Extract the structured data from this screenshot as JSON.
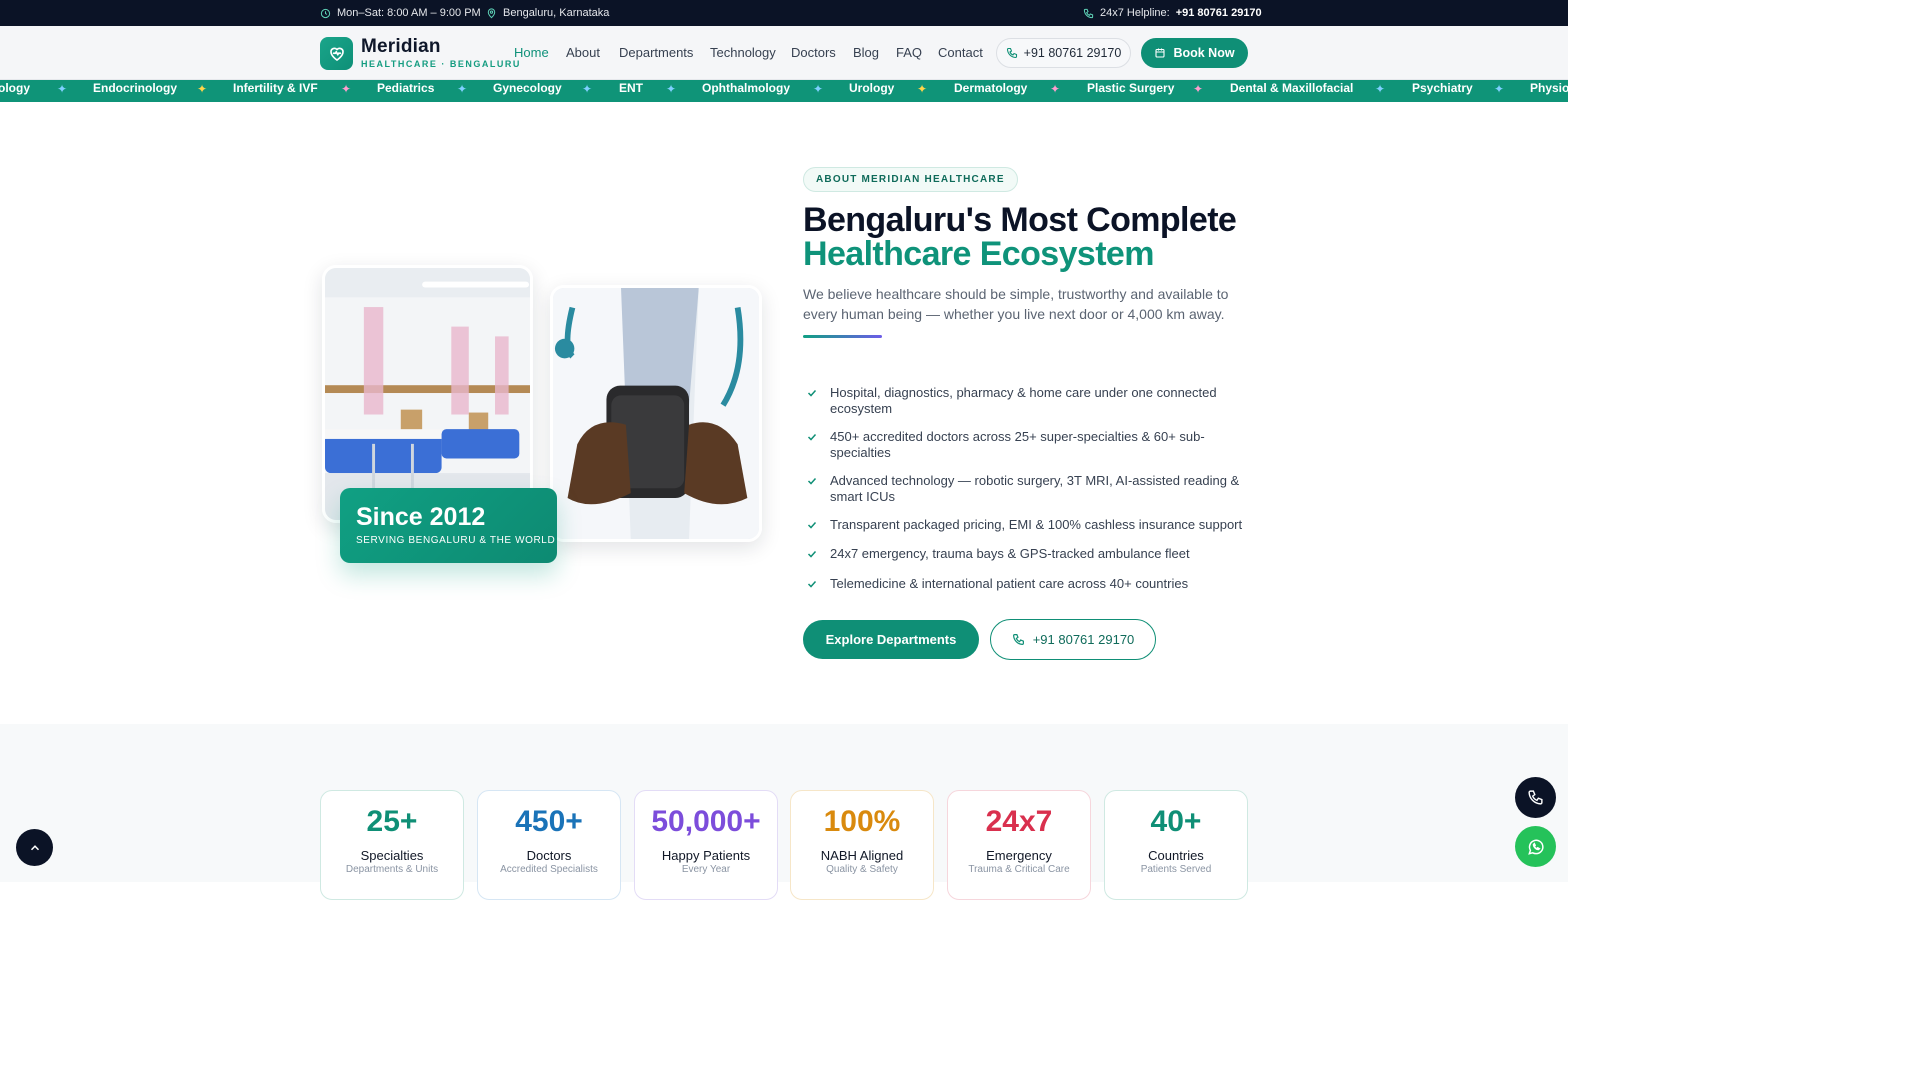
{
  "topbar": {
    "hours": "Mon–Sat: 8:00 AM – 9:00 PM",
    "location": "Bengaluru, Karnataka",
    "helpline_label": "24x7 Helpline:",
    "helpline_number": "+91 80761 29170"
  },
  "nav": {
    "brand": "Meridian",
    "brand_sub": "HEALTHCARE · BENGALURU",
    "items": [
      "Home",
      "About",
      "Departments",
      "Technology",
      "Doctors",
      "Blog",
      "FAQ",
      "Contact"
    ],
    "active": "Home",
    "phone": "+91 80761 29170",
    "book_label": "Book Now"
  },
  "ticker": {
    "items": [
      "ology",
      "Endocrinology",
      "Infertility & IVF",
      "Pediatrics",
      "Gynecology",
      "ENT",
      "Ophthalmology",
      "Urology",
      "Dermatology",
      "Plastic Surgery",
      "Dental & Maxillofacial",
      "Psychiatry",
      "Physio"
    ],
    "star_colors": [
      "#7fd0ff",
      "#ffd54a",
      "#ff9ecf",
      "#7fd0ff",
      "#7fd0ff",
      "#7fd0ff",
      "#7fd0ff",
      "#ffd54a",
      "#ff9ecf",
      "#ff9ecf",
      "#7fd0ff",
      "#7fd0ff"
    ]
  },
  "about": {
    "tag": "ABOUT MERIDIAN HEALTHCARE",
    "heading_line1": "Bengaluru's Most Complete",
    "heading_line2": "Healthcare Ecosystem",
    "lead": "We believe healthcare should be simple, trustworthy and available to every human being — whether you live next door or 4,000 km away.",
    "since_year": "Since 2012",
    "since_sub": "SERVING BENGALURU & THE WORLD",
    "features": [
      "Hospital, diagnostics, pharmacy & home care under one connected ecosystem",
      "450+ accredited doctors across 25+ super-specialties & 60+ sub-specialties",
      "Advanced technology — robotic surgery, 3T MRI, AI-assisted reading & smart ICUs",
      "Transparent packaged pricing, EMI & 100% cashless insurance support",
      "24x7 emergency, trauma bays & GPS-tracked ambulance fleet",
      "Telemedicine & international patient care across 40+ countries"
    ],
    "explore_label": "Explore Departments",
    "call_label": "+91 80761 29170"
  },
  "stats": [
    {
      "value": "25+",
      "label": "Specialties",
      "desc": "Departments & Units",
      "color": "#0f8f76",
      "border": "#cfe9e2"
    },
    {
      "value": "450+",
      "label": "Doctors",
      "desc": "Accredited Specialists",
      "color": "#1a73b8",
      "border": "#d6e6f4"
    },
    {
      "value": "50,000+",
      "label": "Happy Patients",
      "desc": "Every Year",
      "color": "#7c4ddb",
      "border": "#e3dcf6"
    },
    {
      "value": "100%",
      "label": "NABH Aligned",
      "desc": "Quality & Safety",
      "color": "#d98a0e",
      "border": "#f6e6c8"
    },
    {
      "value": "24x7",
      "label": "Emergency",
      "desc": "Trauma & Critical Care",
      "color": "#d9304e",
      "border": "#f6d6dc"
    },
    {
      "value": "40+",
      "label": "Countries",
      "desc": "Patients Served",
      "color": "#0f8f76",
      "border": "#cfe9e2"
    }
  ],
  "icons": {
    "topbar": [
      "clock-icon",
      "location-pin-icon",
      "phone-icon"
    ],
    "logo": "heart-pulse-icon",
    "fabs": [
      "chevron-up-icon",
      "phone-icon",
      "whatsapp-icon"
    ]
  }
}
